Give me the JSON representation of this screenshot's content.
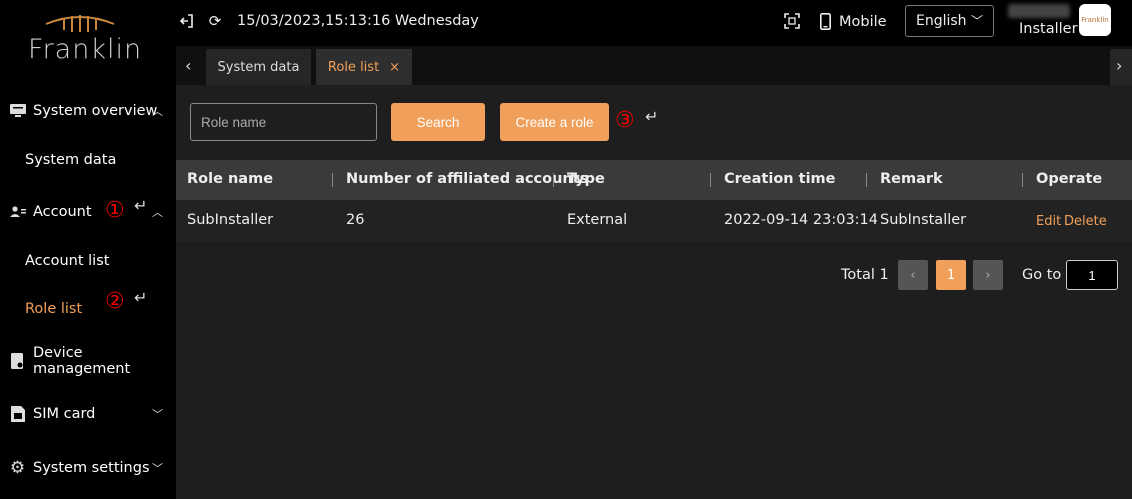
{
  "brand": {
    "name": "Franklin",
    "avatar_text": "Franklin"
  },
  "topbar": {
    "datetime": "15/03/2023,15:13:16 Wednesday",
    "mobile_label": "Mobile",
    "language": "English",
    "user_role": "Installer"
  },
  "sidebar": {
    "system_overview": "System overview",
    "system_data": "System data",
    "account": "Account",
    "account_list": "Account list",
    "role_list": "Role list",
    "device_management": "Device management",
    "sim_card": "SIM card",
    "system_settings": "System settings"
  },
  "annotations": {
    "a1": "①",
    "a2": "②",
    "a3": "③",
    "arrow": "↵"
  },
  "tabs": {
    "system_data": "System data",
    "role_list": "Role list",
    "close": "×"
  },
  "filters": {
    "role_name_placeholder": "Role name",
    "search_label": "Search",
    "create_label": "Create a role"
  },
  "table": {
    "headers": {
      "role_name": "Role name",
      "accounts": "Number of affiliated accounts",
      "type": "Type",
      "creation_time": "Creation time",
      "remark": "Remark",
      "operate": "Operate"
    },
    "rows": [
      {
        "role_name": "SubInstaller",
        "accounts": "26",
        "type": "External",
        "creation_time": "2022-09-14 23:03:14",
        "remark": "SubInstaller",
        "edit": "Edit",
        "delete": "Delete"
      }
    ]
  },
  "pagination": {
    "total": "Total 1",
    "prev": "‹",
    "current": "1",
    "next": "›",
    "goto_label": "Go to",
    "goto_value": "1"
  },
  "colors": {
    "accent": "#f0a05a",
    "annotation": "#ee0000",
    "background": "#000000",
    "content": "#1e1e1e"
  }
}
